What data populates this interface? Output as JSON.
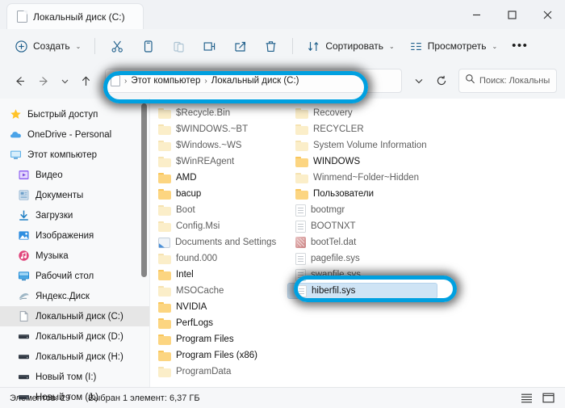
{
  "window": {
    "tab_title": "Локальный диск (C:)",
    "tab_icon": "document-icon",
    "minimize_label": "—",
    "maximize_label": "□",
    "close_label": "✕"
  },
  "toolbar": {
    "new_label": "Создать",
    "new_icon": "plus-circle-icon",
    "cut_icon": "scissors-icon",
    "copy_icon": "copy-icon",
    "paste_icon": "paste-icon",
    "rename_icon": "rename-icon",
    "share_icon": "share-icon",
    "delete_icon": "trash-icon",
    "sort_label": "Сортировать",
    "sort_icon": "sort-arrows-icon",
    "view_label": "Просмотреть",
    "view_icon": "view-list-icon",
    "more_label": "•••"
  },
  "navigation": {
    "back_icon": "arrow-left-icon",
    "forward_icon": "arrow-right-icon",
    "recent_icon": "chevron-down-icon",
    "up_icon": "arrow-up-icon",
    "refresh_icon": "refresh-icon",
    "breadcrumb_dropdown_icon": "chevron-down-icon",
    "breadcrumb": {
      "icon": "drive-document-icon",
      "separator": "›",
      "items": [
        "Этот компьютер",
        "Локальный диск (C:)"
      ]
    }
  },
  "search": {
    "icon": "search-icon",
    "placeholder": "Поиск: Локальны…"
  },
  "sidebar": {
    "items": [
      {
        "label": "Быстрый доступ",
        "icon": "star-icon",
        "indent": false,
        "selected": false
      },
      {
        "label": "OneDrive - Personal",
        "icon": "cloud-icon",
        "indent": false,
        "selected": false
      },
      {
        "label": "Этот компьютер",
        "icon": "monitor-icon",
        "indent": false,
        "selected": false
      },
      {
        "label": "Видео",
        "icon": "video-icon",
        "indent": true,
        "selected": false
      },
      {
        "label": "Документы",
        "icon": "documents-icon",
        "indent": true,
        "selected": false
      },
      {
        "label": "Загрузки",
        "icon": "download-icon",
        "indent": true,
        "selected": false
      },
      {
        "label": "Изображения",
        "icon": "pictures-icon",
        "indent": true,
        "selected": false
      },
      {
        "label": "Музыка",
        "icon": "music-icon",
        "indent": true,
        "selected": false
      },
      {
        "label": "Рабочий стол",
        "icon": "desktop-icon",
        "indent": true,
        "selected": false
      },
      {
        "label": "Яндекс.Диск",
        "icon": "yandex-disk-icon",
        "indent": true,
        "selected": false
      },
      {
        "label": "Локальный диск (C:)",
        "icon": "drive-document-icon",
        "indent": true,
        "selected": true
      },
      {
        "label": "Локальный диск (D:)",
        "icon": "drive-icon",
        "indent": true,
        "selected": false
      },
      {
        "label": "Локальный диск (H:)",
        "icon": "drive-icon",
        "indent": true,
        "selected": false
      },
      {
        "label": "Новый том (I:)",
        "icon": "drive-icon",
        "indent": true,
        "selected": false
      },
      {
        "label": "Новый том (J:)",
        "icon": "drive-icon",
        "indent": true,
        "selected": false
      }
    ]
  },
  "files": {
    "items": [
      {
        "name": "$Recycle.Bin",
        "type": "folder",
        "hidden": true,
        "selected": false
      },
      {
        "name": "$WINDOWS.~BT",
        "type": "folder",
        "hidden": true,
        "selected": false
      },
      {
        "name": "$Windows.~WS",
        "type": "folder",
        "hidden": true,
        "selected": false
      },
      {
        "name": "$WinREAgent",
        "type": "folder",
        "hidden": true,
        "selected": false
      },
      {
        "name": "AMD",
        "type": "folder",
        "hidden": false,
        "selected": false
      },
      {
        "name": "bacup",
        "type": "folder",
        "hidden": false,
        "selected": false
      },
      {
        "name": "Boot",
        "type": "folder",
        "hidden": true,
        "selected": false
      },
      {
        "name": "Config.Msi",
        "type": "folder",
        "hidden": true,
        "selected": false
      },
      {
        "name": "Documents and Settings",
        "type": "shortcut",
        "hidden": true,
        "selected": false
      },
      {
        "name": "found.000",
        "type": "folder",
        "hidden": true,
        "selected": false
      },
      {
        "name": "Intel",
        "type": "folder",
        "hidden": false,
        "selected": false
      },
      {
        "name": "MSOCache",
        "type": "folder",
        "hidden": true,
        "selected": false
      },
      {
        "name": "NVIDIA",
        "type": "folder",
        "hidden": false,
        "selected": false
      },
      {
        "name": "PerfLogs",
        "type": "folder",
        "hidden": false,
        "selected": false
      },
      {
        "name": "Program Files",
        "type": "folder",
        "hidden": false,
        "selected": false
      },
      {
        "name": "Program Files (x86)",
        "type": "folder",
        "hidden": false,
        "selected": false
      },
      {
        "name": "ProgramData",
        "type": "folder",
        "hidden": true,
        "selected": false
      },
      {
        "name": "Recovery",
        "type": "folder",
        "hidden": true,
        "selected": false
      },
      {
        "name": "RECYCLER",
        "type": "folder",
        "hidden": true,
        "selected": false
      },
      {
        "name": "System Volume Information",
        "type": "folder",
        "hidden": true,
        "selected": false
      },
      {
        "name": "WINDOWS",
        "type": "folder",
        "hidden": false,
        "selected": false
      },
      {
        "name": "Winmend~Folder~Hidden",
        "type": "folder",
        "hidden": true,
        "selected": false
      },
      {
        "name": "Пользователи",
        "type": "folder",
        "hidden": false,
        "selected": false
      },
      {
        "name": "bootmgr",
        "type": "sysfile",
        "hidden": true,
        "selected": false
      },
      {
        "name": "BOOTNXT",
        "type": "sysfile",
        "hidden": true,
        "selected": false
      },
      {
        "name": "bootTel.dat",
        "type": "datfile",
        "hidden": true,
        "selected": false
      },
      {
        "name": "pagefile.sys",
        "type": "sysfile",
        "hidden": true,
        "selected": false
      },
      {
        "name": "swapfile.sys",
        "type": "sysfile",
        "hidden": true,
        "selected": false
      },
      {
        "name": "hiberfil.sys",
        "type": "sysfile",
        "hidden": true,
        "selected": true
      }
    ]
  },
  "status": {
    "count_label": "Элементов: 29",
    "selection_label": "Выбран 1 элемент: 6,37 ГБ",
    "list_view_icon": "list-view-icon",
    "details_view_icon": "details-view-icon"
  },
  "annotations": {
    "accent_color": "#00a0e0",
    "address_target": "Локальный диск (C:)",
    "file_target": "hiberfil.sys"
  }
}
